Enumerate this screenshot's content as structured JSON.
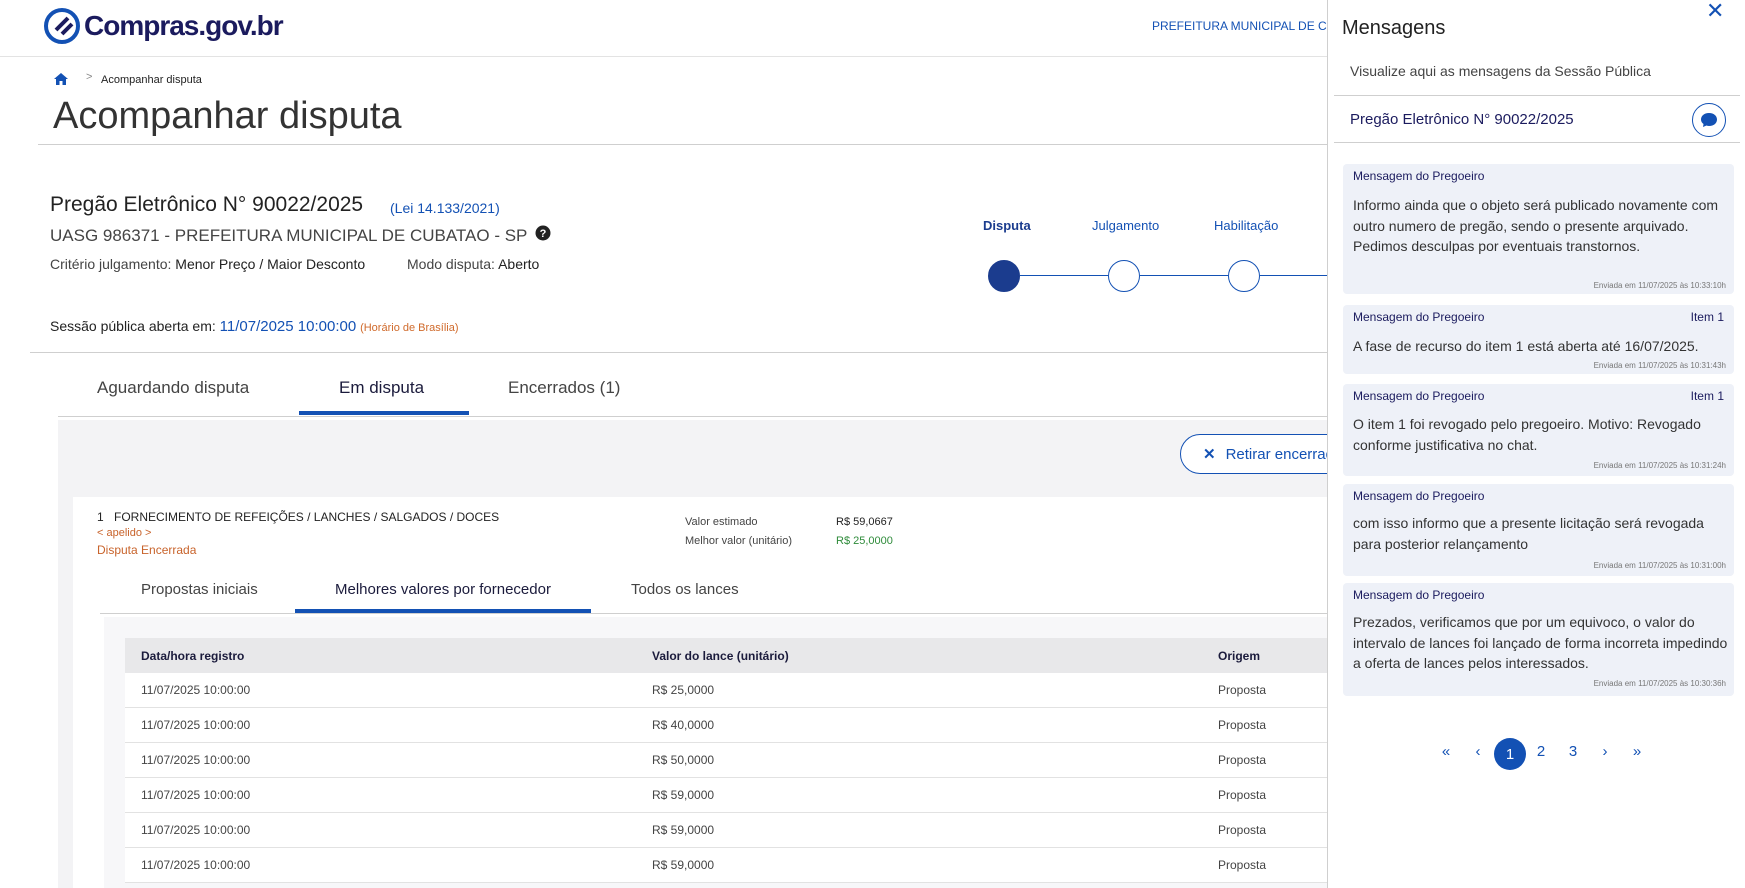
{
  "header": {
    "logo": "Compras.gov.br",
    "org_top": "PREFEITURA MUNICIPAL DE CUBATAO"
  },
  "breadcrumb": {
    "current": "Acompanhar disputa"
  },
  "page_title": "Acompanhar disputa",
  "summary": {
    "pregao": "Pregão Eletrônico N° 90022/2025",
    "lei": "(Lei 14.133/2021)",
    "uasg": "UASG 986371 - PREFEITURA MUNICIPAL DE CUBATAO - SP",
    "criterio_label": "Critério julgamento:",
    "criterio_value": "Menor Preço / Maior Desconto",
    "modo_label": "Modo disputa:",
    "modo_value": "Aberto",
    "sessao_label": "Sessão pública aberta em:",
    "sessao_date": "11/07/2025 10:00:00",
    "sessao_tz": "(Horário de Brasília)"
  },
  "stepper": [
    "Disputa",
    "Julgamento",
    "Habilitação"
  ],
  "tabs": [
    "Aguardando disputa",
    "Em disputa",
    "Encerrados (1)"
  ],
  "retirar_label": "Retirar encerrados",
  "item": {
    "number": "1",
    "description": "FORNECIMENTO DE REFEIÇÕES / LANCHES / SALGADOS / DOCES",
    "apelido": "< apelido >",
    "status": "Disputa Encerrada",
    "valor_estimado_label": "Valor estimado",
    "valor_estimado": "R$ 59,0667",
    "melhor_valor_label": "Melhor valor (unitário)",
    "melhor_valor": "R$ 25,0000"
  },
  "subtabs": [
    "Propostas iniciais",
    "Melhores valores por fornecedor",
    "Todos os lances"
  ],
  "table": {
    "headers": [
      "Data/hora registro",
      "Valor do lance (unitário)",
      "Origem"
    ],
    "rows": [
      [
        "11/07/2025 10:00:00",
        "R$ 25,0000",
        "Proposta"
      ],
      [
        "11/07/2025 10:00:00",
        "R$ 40,0000",
        "Proposta"
      ],
      [
        "11/07/2025 10:00:00",
        "R$ 50,0000",
        "Proposta"
      ],
      [
        "11/07/2025 10:00:00",
        "R$ 59,0000",
        "Proposta"
      ],
      [
        "11/07/2025 10:00:00",
        "R$ 59,0000",
        "Proposta"
      ],
      [
        "11/07/2025 10:00:00",
        "R$ 59,0000",
        "Proposta"
      ]
    ]
  },
  "sidebar": {
    "title": "Mensagens",
    "close": "✕",
    "subtitle": "Visualize aqui as mensagens da Sessão Pública",
    "pregao": "Pregão Eletrônico N° 90022/2025",
    "messages": [
      {
        "from": "Mensagem do Pregoeiro",
        "item": "",
        "body": "Informo ainda que o objeto será publicado novamente com outro numero de pregão, sendo o presente arquivado. Pedimos desculpas por eventuais transtornos.",
        "sent": "Enviada em 11/07/2025 às 10:33:10h"
      },
      {
        "from": "Mensagem do Pregoeiro",
        "item": "Item 1",
        "body": "A fase de recurso do item 1 está aberta até 16/07/2025.",
        "sent": "Enviada em 11/07/2025 às 10:31:43h"
      },
      {
        "from": "Mensagem do Pregoeiro",
        "item": "Item 1",
        "body": "O item 1 foi revogado pelo pregoeiro. Motivo: Revogado conforme justificativa no chat.",
        "sent": "Enviada em 11/07/2025 às 10:31:24h"
      },
      {
        "from": "Mensagem do Pregoeiro",
        "item": "",
        "body": "com isso informo que a presente licitação será revogada para posterior relançamento",
        "sent": "Enviada em 11/07/2025 às 10:31:00h"
      },
      {
        "from": "Mensagem do Pregoeiro",
        "item": "",
        "body": "Prezados, verificamos que por um equivoco, o valor do intervalo de lances foi lançado de forma incorreta impedindo a oferta de lances pelos interessados.",
        "sent": "Enviada em 11/07/2025 às 10:30:36h"
      }
    ],
    "pagination": {
      "first": "«",
      "prev": "‹",
      "current": "1",
      "pages": [
        "2",
        "3"
      ],
      "next": "›",
      "last": "»"
    }
  },
  "colors": {
    "primary": "#1351b4",
    "dark": "#1b3c8e",
    "accent_orange": "#c8632b",
    "green": "#2e8b3a"
  },
  "icons": [
    "home-icon",
    "chevron-right-icon",
    "help-icon",
    "close-icon",
    "chat-icon",
    "logo-icon"
  ]
}
